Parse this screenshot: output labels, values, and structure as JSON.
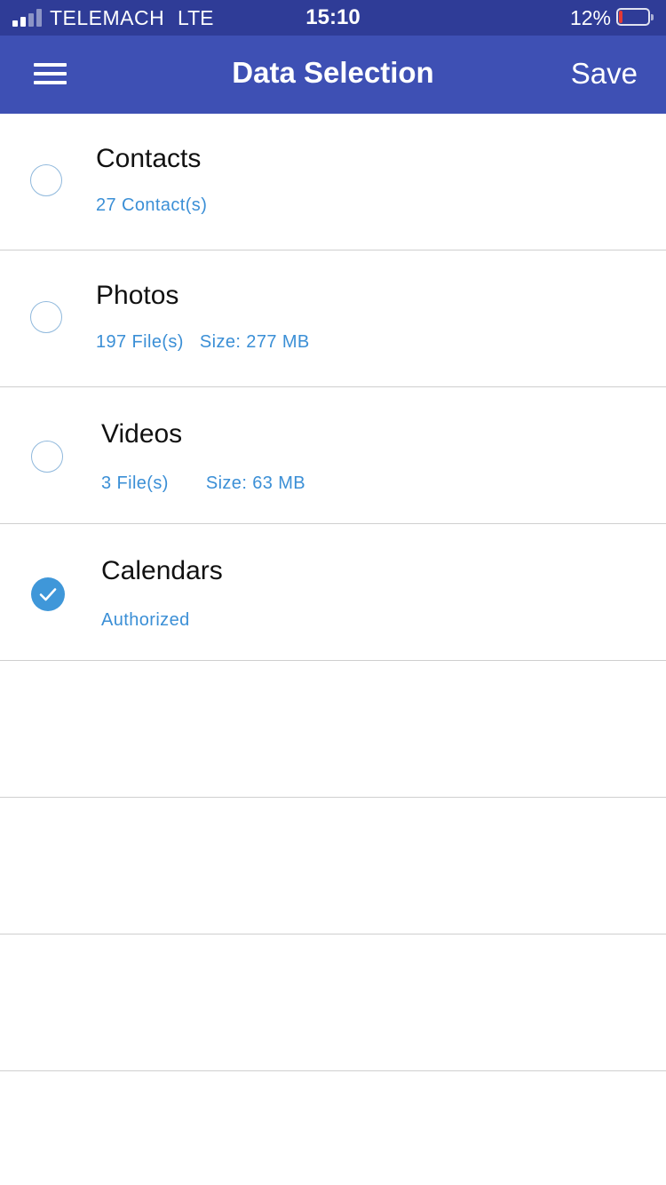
{
  "status_bar": {
    "carrier": "TELEMACH",
    "network": "LTE",
    "time": "15:10",
    "battery_percent": "12%",
    "battery_level": 0.12,
    "battery_color": "#e53935",
    "signal_bars_active": 2,
    "signal_bars_total": 4
  },
  "nav": {
    "menu_icon": "hamburger-menu-icon",
    "title": "Data Selection",
    "save_label": "Save"
  },
  "items": [
    {
      "title": "Contacts",
      "detail": "27 Contact(s)",
      "detail2": "",
      "selected": false
    },
    {
      "title": "Photos",
      "detail": "197 File(s)",
      "detail2": "Size: 277 MB",
      "selected": false
    },
    {
      "title": "Videos",
      "detail": "3 File(s)",
      "detail2": "Size: 63 MB",
      "selected": false
    },
    {
      "title": "Calendars",
      "detail": "Authorized",
      "detail2": "",
      "selected": true
    }
  ],
  "empty_rows": 3,
  "colors": {
    "status_bar": "#2f3c97",
    "nav_bar": "#3e50b4",
    "accent": "#3b8fd6",
    "check_fill": "#3f97d9"
  }
}
